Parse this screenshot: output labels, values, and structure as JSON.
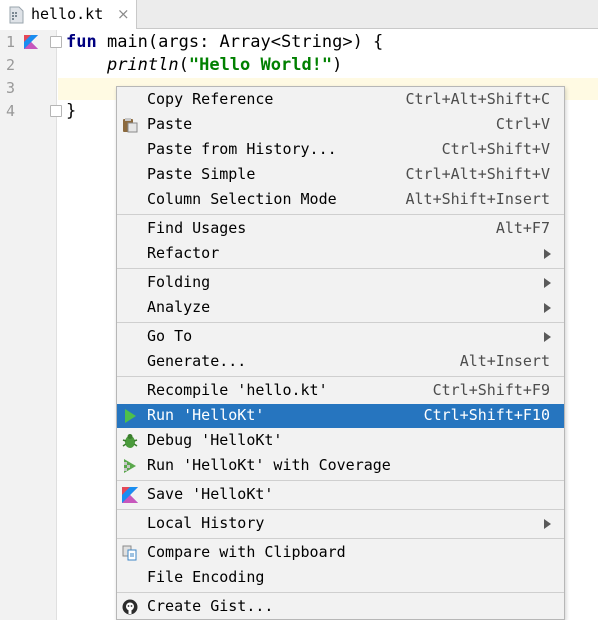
{
  "tab": {
    "filename": "hello.kt",
    "close_glyph": "×"
  },
  "gutter": {
    "line_numbers": [
      "1",
      "2",
      "3",
      "4"
    ]
  },
  "code": {
    "line1": {
      "kw": "fun",
      "rest": " main(args: Array<String>) {"
    },
    "line2": {
      "indent": "    ",
      "fn": "println",
      "open": "(",
      "string": "\"Hello World!\"",
      "close": ")"
    },
    "line4": "}"
  },
  "menu": {
    "copy_reference": {
      "label": "Copy Reference",
      "shortcut": "Ctrl+Alt+Shift+C"
    },
    "paste": {
      "label": "Paste",
      "shortcut": "Ctrl+V",
      "icon": "paste-icon"
    },
    "paste_history": {
      "label": "Paste from History...",
      "shortcut": "Ctrl+Shift+V"
    },
    "paste_simple": {
      "label": "Paste Simple",
      "shortcut": "Ctrl+Alt+Shift+V"
    },
    "column_selection": {
      "label": "Column Selection Mode",
      "shortcut": "Alt+Shift+Insert"
    },
    "find_usages": {
      "label": "Find Usages",
      "shortcut": "Alt+F7"
    },
    "refactor": {
      "label": "Refactor"
    },
    "folding": {
      "label": "Folding"
    },
    "analyze": {
      "label": "Analyze"
    },
    "go_to": {
      "label": "Go To"
    },
    "generate": {
      "label": "Generate...",
      "shortcut": "Alt+Insert"
    },
    "recompile": {
      "label": "Recompile 'hello.kt'",
      "shortcut": "Ctrl+Shift+F9"
    },
    "run": {
      "label": "Run 'HelloKt'",
      "shortcut": "Ctrl+Shift+F10",
      "icon": "run-icon"
    },
    "debug": {
      "label": "Debug 'HelloKt'",
      "icon": "debug-icon"
    },
    "coverage": {
      "label": "Run 'HelloKt' with Coverage",
      "icon": "coverage-icon"
    },
    "save": {
      "label": "Save 'HelloKt'",
      "icon": "kotlin-icon"
    },
    "local_history": {
      "label": "Local History"
    },
    "compare_clipboard": {
      "label": "Compare with Clipboard",
      "icon": "compare-icon"
    },
    "file_encoding": {
      "label": "File Encoding"
    },
    "create_gist": {
      "label": "Create Gist...",
      "icon": "github-icon"
    }
  },
  "colors": {
    "selection": "#2675bf",
    "keyword": "#000080",
    "string": "#008000",
    "caret_line": "#fffae3",
    "menu_bg": "#f2f2f2"
  }
}
